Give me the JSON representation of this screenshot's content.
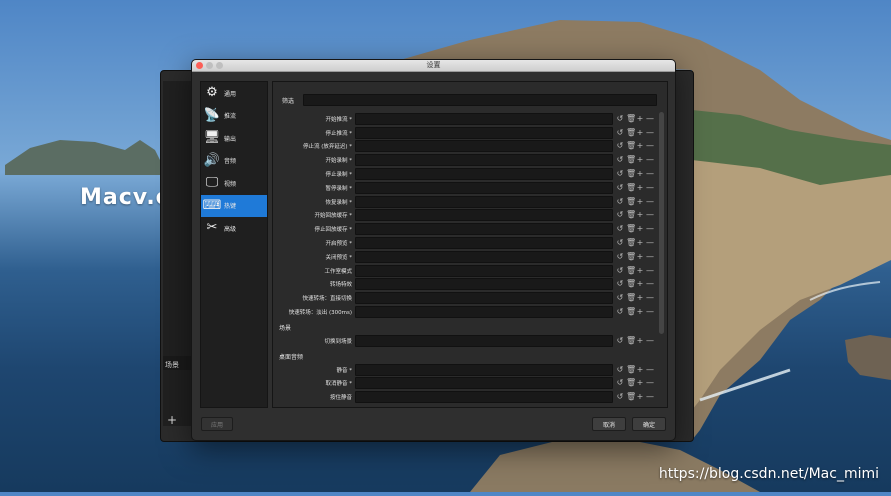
{
  "watermark": "Macv.com",
  "credit": "https://blog.csdn.net/Mac_mimi",
  "background_window": {
    "scene_header": "场景",
    "add_symbol": "+",
    "remove_symbol": "—"
  },
  "window": {
    "title": "设置"
  },
  "sidebar": {
    "items": [
      {
        "label": "通用",
        "icon": "gear-icon",
        "glyph": "⚙"
      },
      {
        "label": "推流",
        "icon": "broadcast-icon",
        "glyph": "📡"
      },
      {
        "label": "输出",
        "icon": "output-icon",
        "glyph": "🖥"
      },
      {
        "label": "音频",
        "icon": "speaker-icon",
        "glyph": "🔊"
      },
      {
        "label": "视频",
        "icon": "monitor-icon",
        "glyph": "🖵"
      },
      {
        "label": "热键",
        "icon": "keyboard-icon",
        "glyph": "⌨",
        "active": true
      },
      {
        "label": "高级",
        "icon": "tools-icon",
        "glyph": "✂"
      }
    ]
  },
  "filter": {
    "label": "筛选",
    "value": ""
  },
  "hotkeys": [
    {
      "label": "开始推流 *"
    },
    {
      "label": "停止推流 *"
    },
    {
      "label": "停止流 (放弃延迟) *"
    },
    {
      "label": "开始录制 *"
    },
    {
      "label": "停止录制 *"
    },
    {
      "label": "暂停录制 *"
    },
    {
      "label": "恢复录制 *"
    },
    {
      "label": "开始回放缓存 *"
    },
    {
      "label": "停止回放缓存 *"
    },
    {
      "label": "开启预览 *"
    },
    {
      "label": "关闭预览 *"
    },
    {
      "label": "工作室模式"
    },
    {
      "label": "转场特效"
    },
    {
      "label": "快速转场：直接切换"
    },
    {
      "label": "快速转场：淡出 (300ms)"
    }
  ],
  "scene_section": {
    "title": "场景",
    "rows": [
      {
        "label": "切换到场景"
      }
    ]
  },
  "desktop_audio_section": {
    "title": "桌面音频",
    "rows": [
      {
        "label": "静音 *"
      },
      {
        "label": "取消静音 *"
      },
      {
        "label": "按住静音"
      }
    ]
  },
  "row_actions": {
    "reset": "↺",
    "delete": "🗑",
    "add": "+",
    "remove": "—"
  },
  "buttons": {
    "apply": "应用",
    "cancel": "取消",
    "ok": "确定"
  }
}
